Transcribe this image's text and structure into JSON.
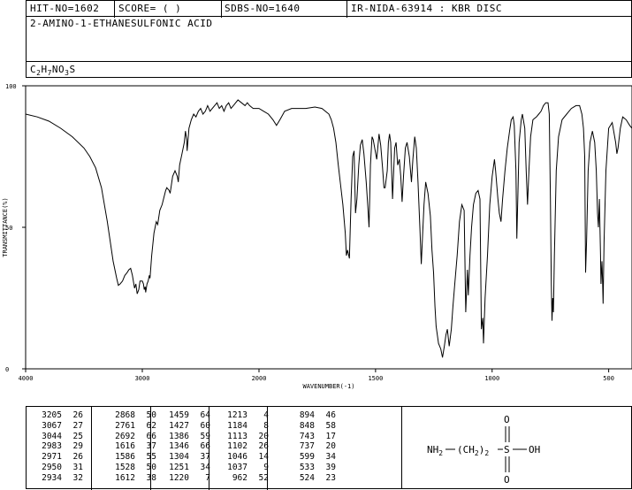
{
  "header": {
    "hit_no": "HIT-NO=1602",
    "score": "SCORE=  (   )",
    "sdbs_no": "SDBS-NO=1640",
    "ir_info": "IR-NIDA-63914 : KBR DISC",
    "compound_name": "2-AMINO-1-ETHANESULFONIC ACID",
    "formula": {
      "C": "C",
      "c_sub": "2",
      "H": "H",
      "h_sub": "7",
      "N": "NO",
      "n_sub": "3",
      "S": "S"
    }
  },
  "chart_data": {
    "type": "line",
    "xlabel": "WAVENUMBER(-1)",
    "ylabel": "TRANSMITTANCE(%)",
    "xlim": [
      4000,
      400
    ],
    "ylim": [
      0,
      100
    ],
    "x_ticks": [
      "4000",
      "3000",
      "2000",
      "1500",
      "1000",
      "500"
    ],
    "x_tick_values": [
      4000,
      3000,
      2000,
      1500,
      1000,
      500
    ],
    "y_ticks": [
      "100",
      "50",
      "0"
    ],
    "y_tick_values": [
      100,
      50,
      0
    ],
    "series": [
      {
        "points": [
          [
            4000,
            90
          ],
          [
            3900,
            89
          ],
          [
            3800,
            87.5
          ],
          [
            3700,
            85
          ],
          [
            3600,
            82
          ],
          [
            3500,
            78
          ],
          [
            3450,
            75
          ],
          [
            3400,
            71
          ],
          [
            3350,
            64
          ],
          [
            3300,
            52
          ],
          [
            3250,
            38
          ],
          [
            3220,
            32
          ],
          [
            3205,
            29.5
          ],
          [
            3190,
            30
          ],
          [
            3170,
            31
          ],
          [
            3150,
            33
          ],
          [
            3130,
            34
          ],
          [
            3115,
            35
          ],
          [
            3100,
            35.5
          ],
          [
            3085,
            33
          ],
          [
            3067,
            28.5
          ],
          [
            3055,
            30
          ],
          [
            3044,
            26.5
          ],
          [
            3030,
            28
          ],
          [
            3020,
            31
          ],
          [
            3000,
            31
          ],
          [
            2990,
            30
          ],
          [
            2983,
            28
          ],
          [
            2975,
            29
          ],
          [
            2971,
            27
          ],
          [
            2960,
            30
          ],
          [
            2950,
            31
          ],
          [
            2940,
            33
          ],
          [
            2934,
            32
          ],
          [
            2920,
            40
          ],
          [
            2900,
            48
          ],
          [
            2880,
            52
          ],
          [
            2868,
            51
          ],
          [
            2850,
            56
          ],
          [
            2830,
            58
          ],
          [
            2800,
            63
          ],
          [
            2790,
            64
          ],
          [
            2770,
            63
          ],
          [
            2761,
            62
          ],
          [
            2740,
            68
          ],
          [
            2720,
            70
          ],
          [
            2700,
            68
          ],
          [
            2692,
            66
          ],
          [
            2680,
            72
          ],
          [
            2660,
            76
          ],
          [
            2640,
            80
          ],
          [
            2630,
            84
          ],
          [
            2620,
            81
          ],
          [
            2616,
            77
          ],
          [
            2600,
            85
          ],
          [
            2580,
            88
          ],
          [
            2560,
            90
          ],
          [
            2540,
            89
          ],
          [
            2520,
            91
          ],
          [
            2500,
            92
          ],
          [
            2480,
            90
          ],
          [
            2460,
            91
          ],
          [
            2440,
            93
          ],
          [
            2420,
            91
          ],
          [
            2400,
            92
          ],
          [
            2380,
            93
          ],
          [
            2360,
            94
          ],
          [
            2340,
            92
          ],
          [
            2320,
            93
          ],
          [
            2300,
            91
          ],
          [
            2280,
            93
          ],
          [
            2260,
            94
          ],
          [
            2240,
            92
          ],
          [
            2220,
            93
          ],
          [
            2200,
            94
          ],
          [
            2180,
            95
          ],
          [
            2150,
            94
          ],
          [
            2120,
            93
          ],
          [
            2100,
            94
          ],
          [
            2080,
            93
          ],
          [
            2050,
            92
          ],
          [
            2000,
            92
          ],
          [
            1980,
            91
          ],
          [
            1960,
            90
          ],
          [
            1940,
            88
          ],
          [
            1925,
            86
          ],
          [
            1910,
            88
          ],
          [
            1890,
            91
          ],
          [
            1860,
            92
          ],
          [
            1800,
            92
          ],
          [
            1760,
            92.5
          ],
          [
            1730,
            92
          ],
          [
            1700,
            90
          ],
          [
            1690,
            88
          ],
          [
            1680,
            85
          ],
          [
            1670,
            80
          ],
          [
            1660,
            72
          ],
          [
            1650,
            65
          ],
          [
            1640,
            58
          ],
          [
            1630,
            48
          ],
          [
            1625,
            40
          ],
          [
            1620,
            42
          ],
          [
            1612,
            39
          ],
          [
            1605,
            60
          ],
          [
            1598,
            75
          ],
          [
            1592,
            77
          ],
          [
            1586,
            55
          ],
          [
            1580,
            60
          ],
          [
            1572,
            72
          ],
          [
            1565,
            79
          ],
          [
            1557,
            81
          ],
          [
            1550,
            76
          ],
          [
            1540,
            66
          ],
          [
            1533,
            57
          ],
          [
            1528,
            50
          ],
          [
            1522,
            72
          ],
          [
            1515,
            82
          ],
          [
            1510,
            81
          ],
          [
            1495,
            74
          ],
          [
            1485,
            83
          ],
          [
            1478,
            79
          ],
          [
            1470,
            71
          ],
          [
            1464,
            64
          ],
          [
            1459,
            64
          ],
          [
            1450,
            70
          ],
          [
            1445,
            80
          ],
          [
            1440,
            83
          ],
          [
            1435,
            80
          ],
          [
            1427,
            60
          ],
          [
            1422,
            70
          ],
          [
            1418,
            78
          ],
          [
            1412,
            80
          ],
          [
            1405,
            72
          ],
          [
            1398,
            74
          ],
          [
            1392,
            68
          ],
          [
            1386,
            59
          ],
          [
            1380,
            68
          ],
          [
            1372,
            78
          ],
          [
            1365,
            80
          ],
          [
            1355,
            75
          ],
          [
            1346,
            66
          ],
          [
            1340,
            74
          ],
          [
            1332,
            82
          ],
          [
            1325,
            78
          ],
          [
            1318,
            66
          ],
          [
            1310,
            50
          ],
          [
            1304,
            37
          ],
          [
            1298,
            48
          ],
          [
            1292,
            58
          ],
          [
            1285,
            66
          ],
          [
            1275,
            62
          ],
          [
            1265,
            54
          ],
          [
            1258,
            42
          ],
          [
            1251,
            34
          ],
          [
            1245,
            22
          ],
          [
            1240,
            15
          ],
          [
            1230,
            9
          ],
          [
            1220,
            7
          ],
          [
            1213,
            4
          ],
          [
            1205,
            8
          ],
          [
            1198,
            12
          ],
          [
            1192,
            14
          ],
          [
            1184,
            8
          ],
          [
            1175,
            14
          ],
          [
            1168,
            22
          ],
          [
            1160,
            30
          ],
          [
            1150,
            40
          ],
          [
            1140,
            52
          ],
          [
            1130,
            58
          ],
          [
            1120,
            56
          ],
          [
            1113,
            20
          ],
          [
            1106,
            35
          ],
          [
            1102,
            26
          ],
          [
            1095,
            40
          ],
          [
            1088,
            50
          ],
          [
            1080,
            58
          ],
          [
            1070,
            62
          ],
          [
            1060,
            63
          ],
          [
            1052,
            60
          ],
          [
            1046,
            14
          ],
          [
            1040,
            18
          ],
          [
            1037,
            9
          ],
          [
            1030,
            25
          ],
          [
            1020,
            40
          ],
          [
            1010,
            58
          ],
          [
            1000,
            68
          ],
          [
            990,
            74
          ],
          [
            985,
            70
          ],
          [
            975,
            60
          ],
          [
            969,
            55
          ],
          [
            962,
            52
          ],
          [
            955,
            60
          ],
          [
            945,
            70
          ],
          [
            935,
            78
          ],
          [
            925,
            84
          ],
          [
            918,
            88
          ],
          [
            910,
            89
          ],
          [
            905,
            86
          ],
          [
            898,
            70
          ],
          [
            894,
            46
          ],
          [
            890,
            60
          ],
          [
            884,
            80
          ],
          [
            875,
            88
          ],
          [
            870,
            90
          ],
          [
            860,
            85
          ],
          [
            854,
            70
          ],
          [
            848,
            58
          ],
          [
            842,
            70
          ],
          [
            835,
            82
          ],
          [
            825,
            88
          ],
          [
            810,
            89
          ],
          [
            800,
            90
          ],
          [
            790,
            91
          ],
          [
            780,
            93
          ],
          [
            770,
            94
          ],
          [
            760,
            94
          ],
          [
            755,
            90
          ],
          [
            750,
            60
          ],
          [
            746,
            30
          ],
          [
            743,
            17
          ],
          [
            740,
            25
          ],
          [
            737,
            20
          ],
          [
            733,
            40
          ],
          [
            725,
            70
          ],
          [
            715,
            82
          ],
          [
            700,
            88
          ],
          [
            680,
            90
          ],
          [
            660,
            92
          ],
          [
            640,
            93
          ],
          [
            625,
            93
          ],
          [
            615,
            90
          ],
          [
            608,
            85
          ],
          [
            603,
            75
          ],
          [
            599,
            34
          ],
          [
            595,
            45
          ],
          [
            588,
            70
          ],
          [
            580,
            80
          ],
          [
            570,
            84
          ],
          [
            560,
            80
          ],
          [
            553,
            70
          ],
          [
            548,
            55
          ],
          [
            544,
            50
          ],
          [
            540,
            60
          ],
          [
            535,
            40
          ],
          [
            533,
            30
          ],
          [
            529,
            38
          ],
          [
            526,
            30
          ],
          [
            524,
            23
          ],
          [
            520,
            45
          ],
          [
            512,
            70
          ],
          [
            500,
            85
          ],
          [
            485,
            87
          ],
          [
            470,
            80
          ],
          [
            465,
            76
          ],
          [
            460,
            78
          ],
          [
            450,
            85
          ],
          [
            440,
            89
          ],
          [
            425,
            88
          ],
          [
            410,
            86
          ],
          [
            400,
            85
          ]
        ]
      }
    ]
  },
  "peak_table": {
    "columns": [
      [
        [
          "3205",
          "26"
        ],
        [
          "3067",
          "27"
        ],
        [
          "3044",
          "25"
        ],
        [
          "2983",
          "29"
        ],
        [
          "2971",
          "26"
        ],
        [
          "2950",
          "31"
        ],
        [
          "2934",
          "32"
        ]
      ],
      [
        [
          "2868",
          "50"
        ],
        [
          "2761",
          "62"
        ],
        [
          "2692",
          "66"
        ],
        [
          "1616",
          "37"
        ],
        [
          "1586",
          "55"
        ],
        [
          "1528",
          "50"
        ],
        [
          "1612",
          "38"
        ]
      ],
      [
        [
          "1459",
          "64"
        ],
        [
          "1427",
          "60"
        ],
        [
          "1386",
          "59"
        ],
        [
          "1346",
          "66"
        ],
        [
          "1304",
          "37"
        ],
        [
          "1251",
          "34"
        ],
        [
          "1220",
          "7"
        ]
      ],
      [
        [
          "1213",
          "4"
        ],
        [
          "1184",
          "8"
        ],
        [
          "1113",
          "20"
        ],
        [
          "1102",
          "26"
        ],
        [
          "1046",
          "14"
        ],
        [
          "1037",
          "9"
        ],
        [
          "962",
          "52"
        ]
      ],
      [
        [
          "894",
          "46"
        ],
        [
          "848",
          "58"
        ],
        [
          "743",
          "17"
        ],
        [
          "737",
          "20"
        ],
        [
          "599",
          "34"
        ],
        [
          "533",
          "39"
        ],
        [
          "524",
          "23"
        ]
      ]
    ]
  },
  "structure": {
    "o_top": "O",
    "o_bottom": "O",
    "nh": "NH",
    "nh_sub": "2",
    "chain": "(CH",
    "chain_sub": "2",
    "chain_close": ")",
    "chain_count": "2",
    "s": "S",
    "oh": "OH"
  }
}
